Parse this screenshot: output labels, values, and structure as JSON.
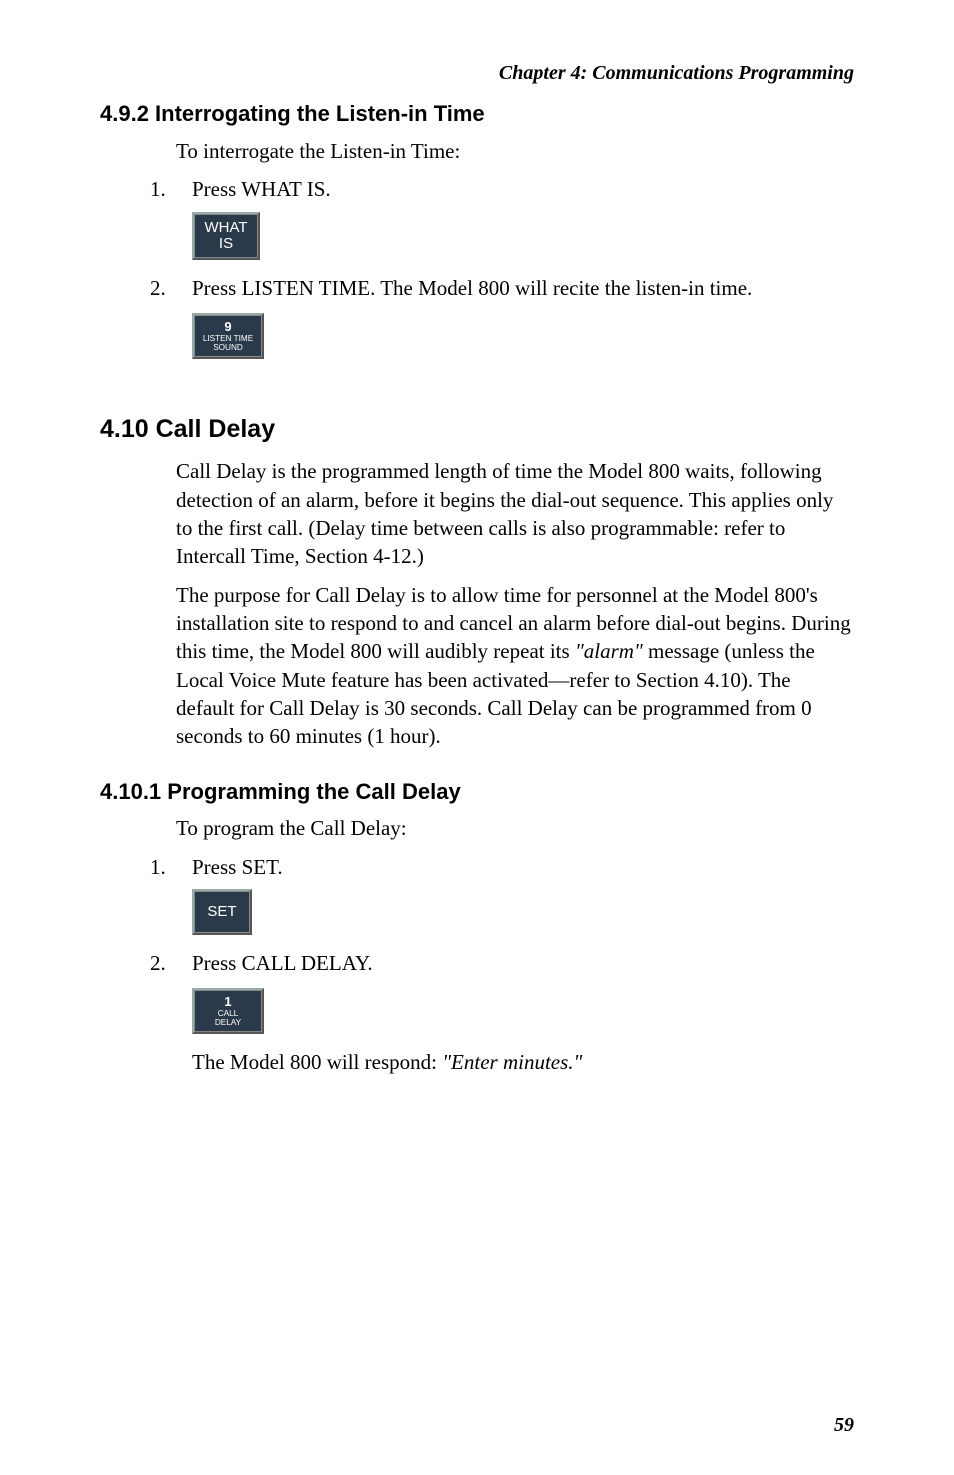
{
  "header": {
    "chapter": "Chapter 4:  Communications Programming"
  },
  "sec492": {
    "heading": "4.9.2  Interrogating the Listen-in Time",
    "intro": "To interrogate the Listen-in Time:",
    "step1_num": "1.",
    "step1": "Press WHAT IS.",
    "btn_what_l1": "WHAT",
    "btn_what_l2": "IS",
    "step2_num": "2.",
    "step2": "Press LISTEN TIME. The Model 800 will recite the listen-in time.",
    "btn9_n": "9",
    "btn9_l1": "LISTEN TIME",
    "btn9_l2": "SOUND"
  },
  "sec410": {
    "heading": "4.10  Call Delay",
    "p1": "Call Delay is the programmed length of time the Model 800 waits, following detection of an alarm, before it begins the dial-out sequence. This applies only to the first call. (Delay time between calls is also programmable: refer to Intercall Time, Section 4-12.)",
    "p2a": "The purpose for Call Delay is to allow time for personnel at the Model 800's installation site to respond to and cancel an alarm before dial-out begins. During this time, the Model 800 will audibly repeat its ",
    "p2_em": "\"alarm\"",
    "p2b": " message (unless the Local Voice Mute feature has been activated—refer to Section 4.10). The default for Call Delay is 30 seconds. Call Delay can be programmed from 0 seconds to 60 minutes (1 hour)."
  },
  "sec4101": {
    "heading": "4.10.1  Programming the Call Delay",
    "intro": "To program the Call Delay:",
    "step1_num": "1.",
    "step1": "Press SET.",
    "btn_set": "SET",
    "step2_num": "2.",
    "step2": "Press CALL DELAY.",
    "btn1_n": "1",
    "btn1_l1": "CALL",
    "btn1_l2": "DELAY",
    "resp_a": "The Model 800 will respond: ",
    "resp_em": "\"Enter minutes.\""
  },
  "page": "59"
}
